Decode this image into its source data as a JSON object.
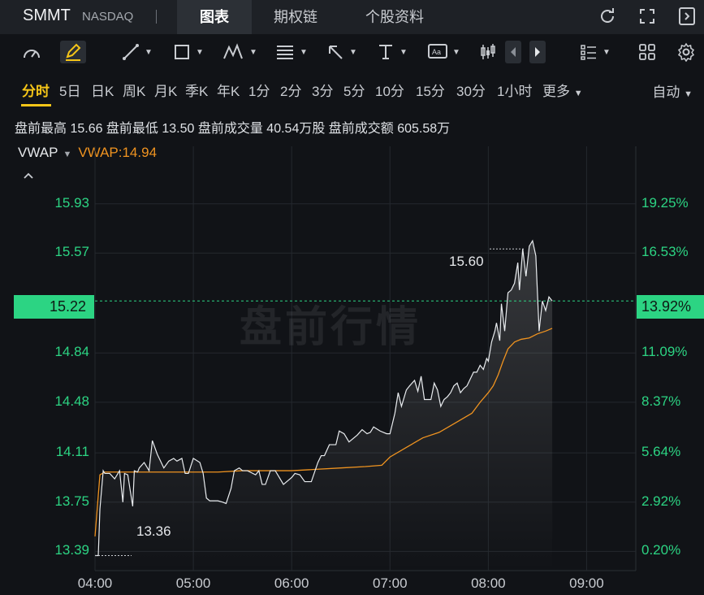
{
  "header": {
    "symbol": "SMMT",
    "exchange": "NASDAQ",
    "tabs": [
      {
        "label": "图表",
        "active": true
      },
      {
        "label": "期权链",
        "active": false
      },
      {
        "label": "个股资料",
        "active": false
      }
    ],
    "icons": [
      "refresh-icon",
      "fullscreen-icon",
      "collapse-panel-icon"
    ]
  },
  "toolbar": {
    "tools": [
      "gauge-icon",
      "draw-pen-icon",
      "line-tool-icon",
      "rectangle-tool-icon",
      "pattern-tool-icon",
      "fibonacci-tool-icon",
      "arrow-tool-icon",
      "text-tool-icon",
      "annotation-tool-icon",
      "candlestick-icon",
      "prev-icon",
      "next-icon",
      "layout-list-icon",
      "grid-icon",
      "settings-icon"
    ]
  },
  "periods": {
    "items": [
      "分时",
      "5日",
      "日K",
      "周K",
      "月K",
      "季K",
      "年K",
      "1分",
      "2分",
      "3分",
      "5分",
      "10分",
      "15分",
      "30分",
      "1小时",
      "更多"
    ],
    "active": "分时",
    "auto_label": "自动"
  },
  "stats": {
    "text": "盘前最高 15.66 盘前最低 13.50 盘前成交量 40.54万股 盘前成交额 605.58万"
  },
  "indicator": {
    "name": "VWAP",
    "value_label": "VWAP:14.94"
  },
  "current": {
    "price": "15.22",
    "pct": "13.92%"
  },
  "annotations": {
    "high": "15.60",
    "low": "13.36"
  },
  "watermark": "盘前行情",
  "colors": {
    "up": "#2cd483",
    "vwap": "#ef9320",
    "price_line": "#e9ecef",
    "accent": "#f5c518"
  },
  "chart_data": {
    "type": "line",
    "y_ticks_left": [
      "15.93",
      "15.57",
      "14.84",
      "14.48",
      "14.11",
      "13.75",
      "13.39"
    ],
    "y_ticks_right": [
      "19.25%",
      "16.53%",
      "11.09%",
      "8.37%",
      "5.64%",
      "2.92%",
      "0.20%"
    ],
    "x_ticks": [
      "04:00",
      "05:00",
      "06:00",
      "07:00",
      "08:00",
      "09:00"
    ],
    "ylim": [
      13.25,
      16.35
    ],
    "xlim": [
      0,
      330
    ],
    "grid": true,
    "series": [
      {
        "name": "",
        "x": [
          0,
          2,
          3,
          5,
          6,
          9,
          12,
          15,
          17,
          18,
          20,
          23,
          24,
          26,
          27,
          30,
          33,
          35,
          38,
          40,
          42,
          45,
          48,
          50,
          53,
          55,
          57,
          60,
          64,
          66,
          68,
          70,
          75,
          78,
          80,
          83,
          85,
          88,
          90,
          93,
          98,
          100,
          102,
          104,
          107,
          110,
          115,
          120,
          122,
          125,
          128,
          132,
          136,
          138,
          140,
          143,
          145,
          147,
          149,
          152,
          155,
          160,
          163,
          166,
          168,
          170,
          174,
          178,
          180,
          183,
          185,
          187,
          190,
          192,
          195,
          197,
          199,
          201,
          203,
          205,
          207,
          209,
          211,
          213,
          215,
          217,
          219,
          221,
          223,
          225,
          227,
          229,
          231,
          233,
          235,
          237,
          239,
          240,
          242,
          244,
          245,
          247,
          248,
          250,
          252,
          254,
          256,
          258,
          259,
          261,
          263,
          265,
          267,
          269,
          271,
          273,
          275,
          277,
          279
        ],
        "values": [
          13.36,
          13.36,
          13.7,
          13.98,
          13.96,
          13.96,
          13.92,
          13.98,
          13.75,
          13.96,
          13.95,
          13.72,
          13.98,
          13.97,
          14.0,
          14.04,
          13.98,
          14.2,
          14.1,
          14.05,
          14.0,
          14.05,
          14.07,
          14.05,
          14.07,
          13.96,
          13.96,
          14.07,
          14.04,
          13.96,
          13.78,
          13.76,
          13.76,
          13.75,
          13.74,
          13.85,
          13.98,
          14.0,
          13.98,
          13.98,
          13.95,
          13.98,
          13.88,
          13.88,
          13.98,
          13.98,
          13.88,
          13.93,
          13.96,
          13.95,
          13.9,
          13.9,
          14.04,
          14.09,
          14.09,
          14.17,
          14.17,
          14.17,
          14.27,
          14.25,
          14.19,
          14.24,
          14.28,
          14.25,
          14.26,
          14.3,
          14.27,
          14.25,
          14.25,
          14.4,
          14.55,
          14.45,
          14.57,
          14.6,
          14.64,
          14.56,
          14.67,
          14.5,
          14.5,
          14.5,
          14.62,
          14.57,
          14.45,
          14.5,
          14.52,
          14.55,
          14.6,
          14.62,
          14.55,
          14.58,
          14.6,
          14.65,
          14.7,
          14.7,
          14.75,
          14.72,
          14.8,
          14.78,
          14.92,
          15.0,
          15.06,
          14.93,
          15.2,
          15.0,
          15.28,
          15.3,
          15.35,
          15.5,
          15.3,
          15.6,
          15.4,
          15.62,
          15.66,
          15.55,
          15.0,
          15.22,
          15.15,
          15.25,
          15.22
        ]
      },
      {
        "name": "VWAP",
        "x": [
          0,
          3,
          6,
          15,
          30,
          45,
          60,
          75,
          90,
          105,
          120,
          135,
          150,
          165,
          175,
          180,
          190,
          200,
          210,
          220,
          230,
          235,
          240,
          243,
          246,
          249,
          252,
          256,
          260,
          265,
          270,
          275,
          279
        ],
        "values": [
          13.5,
          13.95,
          13.97,
          13.97,
          13.97,
          13.97,
          13.97,
          13.97,
          13.98,
          13.98,
          13.98,
          13.99,
          14.0,
          14.01,
          14.02,
          14.08,
          14.15,
          14.22,
          14.26,
          14.33,
          14.4,
          14.48,
          14.55,
          14.6,
          14.68,
          14.78,
          14.87,
          14.92,
          14.94,
          14.95,
          14.98,
          15.0,
          15.02
        ]
      }
    ]
  }
}
